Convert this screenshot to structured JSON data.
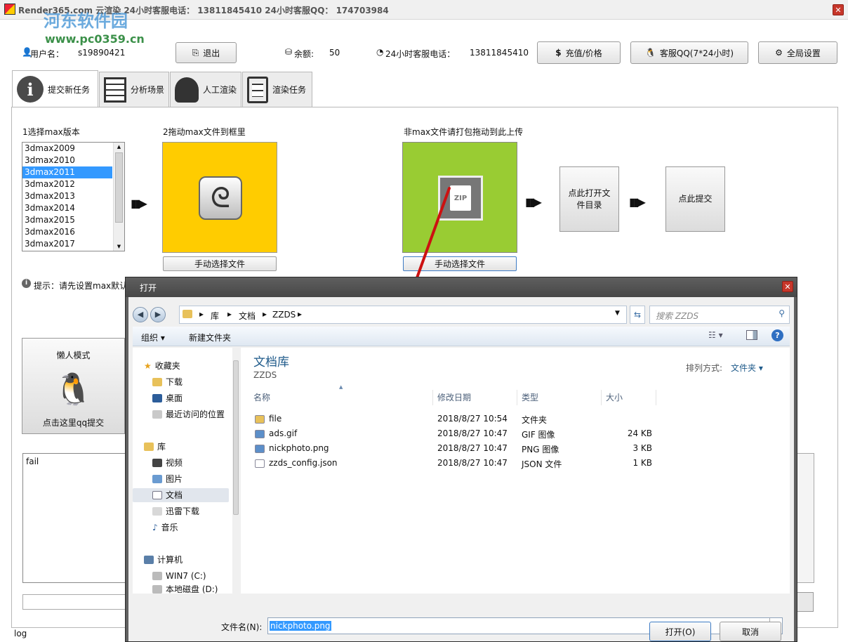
{
  "window": {
    "title": "Render365.com  云渲染  24小时客服电话：  13811845410    24小时客服QQ：  174703984",
    "watermark_name": "河东软件园",
    "watermark_url": "www.pc0359.cn"
  },
  "header": {
    "username_label": "用户名：",
    "username": "s19890421",
    "exit_label": "退出",
    "balance_label": "余额:",
    "balance": "50",
    "phone_label": "24小时客服电话：",
    "phone": "13811845410",
    "recharge_label": "充值/价格",
    "qq_label": "客服QQ(7*24小时)",
    "settings_label": "全局设置"
  },
  "tabs": [
    {
      "label": "提交新任务",
      "icon": "info-icon"
    },
    {
      "label": "分析场景",
      "icon": "server-icon"
    },
    {
      "label": "人工渲染",
      "icon": "support-agent-icon"
    },
    {
      "label": "渲染任务",
      "icon": "document-icon"
    }
  ],
  "main": {
    "step1_label": "1选择max版本",
    "versions": [
      "3dmax2009",
      "3dmax2010",
      "3dmax2011",
      "3dmax2012",
      "3dmax2013",
      "3dmax2014",
      "3dmax2015",
      "3dmax2016",
      "3dmax2017"
    ],
    "selected_version": "3dmax2011",
    "step2_label": "2拖动max文件到框里",
    "manual_select_label": "手动选择文件",
    "nonmax_label": "非max文件请打包拖动到此上传",
    "zip_text": "ZIP",
    "manual_select_label_2": "手动选择文件",
    "open_dir_label": "点此打开文件目录",
    "submit_label": "点此提交",
    "hint": "提示：请先设置max默认",
    "lazy_mode_label": "懒人模式",
    "lazy_click_label": "点击这里qq提交",
    "log_text": "fail",
    "status_text": "log"
  },
  "dialog": {
    "title": "打开",
    "path": [
      "库",
      "文档",
      "ZZDS"
    ],
    "search_placeholder": "搜索 ZZDS",
    "organize_label": "组织",
    "new_folder_label": "新建文件夹",
    "library_title": "文档库",
    "library_sub": "ZZDS",
    "sort_label": "排列方式:",
    "sort_value": "文件夹",
    "columns": {
      "name": "名称",
      "date": "修改日期",
      "type": "类型",
      "size": "大小"
    },
    "nav": {
      "favorites": "收藏夹",
      "downloads": "下载",
      "desktop": "桌面",
      "recent": "最近访问的位置",
      "libraries": "库",
      "videos": "视频",
      "pictures": "图片",
      "documents": "文档",
      "thunder": "迅雷下载",
      "music": "音乐",
      "computer": "计算机",
      "drive_c": "WIN7 (C:)",
      "drive_d": "本地磁盘 (D:)"
    },
    "files": [
      {
        "name": "file",
        "date": "2018/8/27 10:54",
        "type": "文件夹",
        "size": "",
        "icon": "folder-icon"
      },
      {
        "name": "ads.gif",
        "date": "2018/8/27 10:47",
        "type": "GIF 图像",
        "size": "24 KB",
        "icon": "image-icon"
      },
      {
        "name": "nickphoto.png",
        "date": "2018/8/27 10:47",
        "type": "PNG 图像",
        "size": "3 KB",
        "icon": "image-icon"
      },
      {
        "name": "zzds_config.json",
        "date": "2018/8/27 10:47",
        "type": "JSON 文件",
        "size": "1 KB",
        "icon": "file-icon"
      }
    ],
    "filename_label": "文件名(N):",
    "filename_value": "nickphoto.png",
    "open_label": "打开(O)",
    "cancel_label": "取消"
  }
}
